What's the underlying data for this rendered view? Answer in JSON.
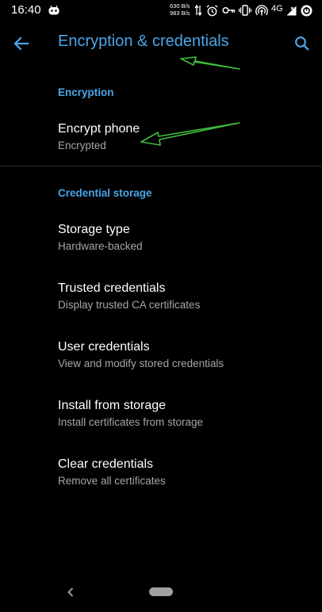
{
  "status_bar": {
    "time": "16:40",
    "net_speed_up": "630 B/s",
    "net_speed_down": "983 B/s",
    "network_type": "4G",
    "icons": [
      "notification-icon",
      "data-transfer-icon",
      "alarm-icon",
      "key-icon",
      "vibrate-icon",
      "hotspot-icon",
      "signal-icon",
      "battery-saver-icon"
    ]
  },
  "toolbar": {
    "title": "Encryption & credentials",
    "back_icon": "arrow-back-icon",
    "search_icon": "search-icon"
  },
  "sections": {
    "encryption": {
      "header": "Encryption",
      "items": [
        {
          "title": "Encrypt phone",
          "summary": "Encrypted"
        }
      ]
    },
    "credential_storage": {
      "header": "Credential storage",
      "items": [
        {
          "title": "Storage type",
          "summary": "Hardware-backed"
        },
        {
          "title": "Trusted credentials",
          "summary": "Display trusted CA certificates"
        },
        {
          "title": "User credentials",
          "summary": "View and modify stored credentials"
        },
        {
          "title": "Install from storage",
          "summary": "Install certificates from storage"
        },
        {
          "title": "Clear credentials",
          "summary": "Remove all certificates"
        }
      ]
    }
  },
  "colors": {
    "accent": "#4aa5e8",
    "background": "#000000",
    "primary_text": "#ffffff",
    "secondary_text": "#a6a6a6",
    "annotation": "#3fbf3f"
  }
}
